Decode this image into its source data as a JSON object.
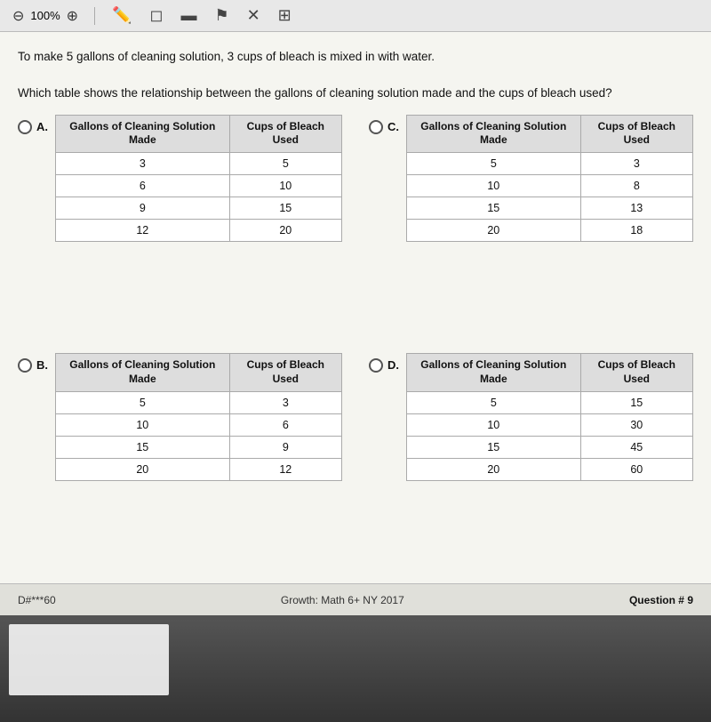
{
  "toolbar": {
    "zoom": "100%",
    "icons": [
      "pencil",
      "eraser",
      "lines",
      "flag",
      "cross",
      "grid"
    ]
  },
  "question": {
    "line1": "To make 5 gallons of cleaning solution, 3 cups of bleach is mixed in with water.",
    "line2": "Which table shows the relationship between the gallons of cleaning solution made and the cups of bleach used?"
  },
  "options": {
    "A": {
      "label": "A.",
      "col1_header": "Gallons of Cleaning Solution Made",
      "col2_header": "Cups of Bleach Used",
      "rows": [
        {
          "col1": "3",
          "col2": "5"
        },
        {
          "col1": "6",
          "col2": "10"
        },
        {
          "col1": "9",
          "col2": "15"
        },
        {
          "col1": "12",
          "col2": "20"
        }
      ]
    },
    "B": {
      "label": "B.",
      "col1_header": "Gallons of Cleaning Solution Made",
      "col2_header": "Cups of Bleach Used",
      "rows": [
        {
          "col1": "5",
          "col2": "3"
        },
        {
          "col1": "10",
          "col2": "6"
        },
        {
          "col1": "15",
          "col2": "9"
        },
        {
          "col1": "20",
          "col2": "12"
        }
      ]
    },
    "C": {
      "label": "C.",
      "col1_header": "Gallons of Cleaning Solution Made",
      "col2_header": "Cups of Bleach Used",
      "rows": [
        {
          "col1": "5",
          "col2": "3"
        },
        {
          "col1": "10",
          "col2": "8"
        },
        {
          "col1": "15",
          "col2": "13"
        },
        {
          "col1": "20",
          "col2": "18"
        }
      ]
    },
    "D": {
      "label": "D.",
      "col1_header": "Gallons of Cleaning Solution Made",
      "col2_header": "Cups of Bleach Used",
      "rows": [
        {
          "col1": "5",
          "col2": "15"
        },
        {
          "col1": "10",
          "col2": "30"
        },
        {
          "col1": "15",
          "col2": "45"
        },
        {
          "col1": "20",
          "col2": "60"
        }
      ]
    }
  },
  "footer": {
    "code": "D#***60",
    "title": "Growth: Math 6+ NY 2017",
    "question_label": "Question # 9"
  }
}
